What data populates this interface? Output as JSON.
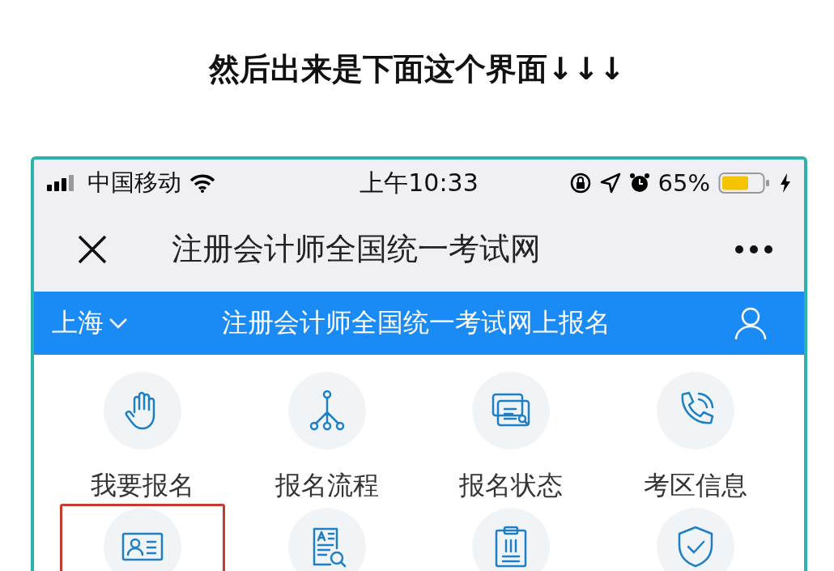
{
  "caption": "然后出来是下面这个界面↓↓↓",
  "status_bar": {
    "carrier": "中国移动",
    "time": "上午10:33",
    "battery_percent": "65%"
  },
  "nav_bar": {
    "title": "注册会计师全国统一考试网"
  },
  "header": {
    "city": "上海",
    "title": "注册会计师全国统一考试网上报名"
  },
  "grid": [
    {
      "kind": "hand",
      "label": "我要报名",
      "highlighted": false
    },
    {
      "kind": "tree",
      "label": "报名流程",
      "highlighted": false
    },
    {
      "kind": "cards",
      "label": "报名状态",
      "highlighted": false
    },
    {
      "kind": "phone",
      "label": "考区信息",
      "highlighted": false
    },
    {
      "kind": "idcard",
      "highlighted": true
    },
    {
      "kind": "docsearch",
      "highlighted": false
    },
    {
      "kind": "clipboard",
      "highlighted": false
    },
    {
      "kind": "shield",
      "highlighted": false
    }
  ]
}
